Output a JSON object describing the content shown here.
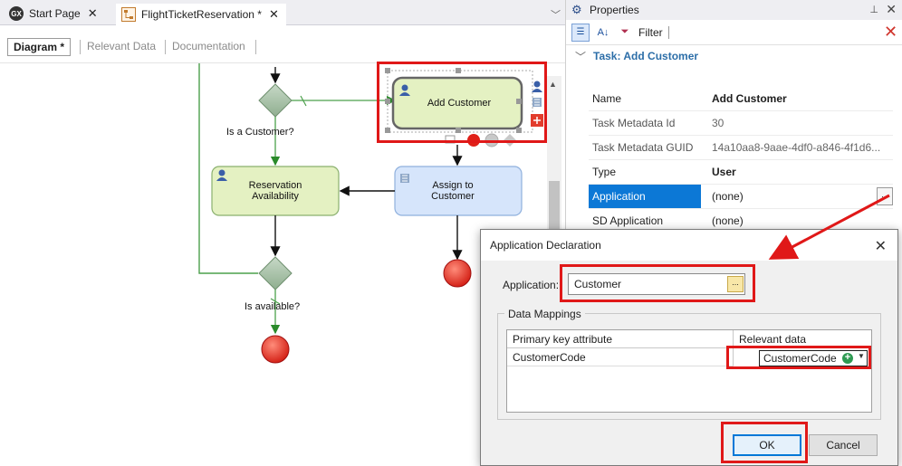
{
  "tabs": {
    "start_page": "Start Page",
    "flight": "FlightTicketReservation *",
    "close_glyph": "✕",
    "logo_text": "GX"
  },
  "subtabs": {
    "diagram": "Diagram *",
    "relevant_data": "Relevant Data",
    "documentation": "Documentation"
  },
  "diagram": {
    "add_customer": "Add Customer",
    "is_customer": "Is a Customer?",
    "reservation": "Reservation Availability",
    "assign": "Assign to Customer",
    "is_available": "Is available?"
  },
  "properties": {
    "title": "Properties",
    "filter_label": "Filter",
    "section": "Task: Add Customer",
    "rows": [
      {
        "key": "Name",
        "value": "Add Customer"
      },
      {
        "key": "Task Metadata Id",
        "value": "30"
      },
      {
        "key": "Task Metadata GUID",
        "value": "14a10aa8-9aae-4df0-a846-4f1d6..."
      },
      {
        "key": "Type",
        "value": "User"
      },
      {
        "key": "Application",
        "value": "(none)"
      },
      {
        "key": "SD Application",
        "value": "(none)"
      }
    ]
  },
  "dialog": {
    "title": "Application Declaration",
    "app_label": "Application:",
    "app_value": "Customer",
    "mappings_label": "Data Mappings",
    "col_primary": "Primary key attribute",
    "col_relevant": "Relevant data",
    "row_primary": "CustomerCode",
    "row_relevant": "CustomerCode",
    "ok": "OK",
    "cancel": "Cancel"
  },
  "colors": {
    "highlight_red": "#e01818",
    "selection_blue": "#0c78d6",
    "task_green": "#e4f1c2",
    "task_blue": "#d6e5fb"
  }
}
